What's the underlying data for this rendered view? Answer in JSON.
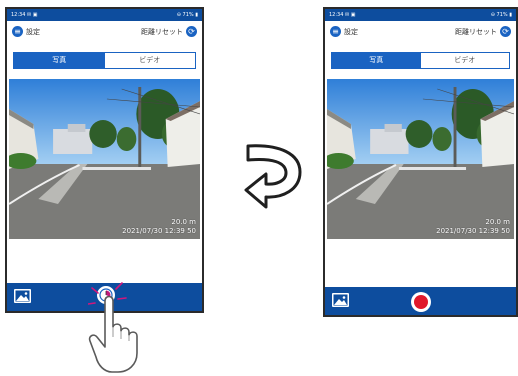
{
  "left_phone": {
    "statusbar": {
      "time": "12:34 ✉ ▣",
      "right": "⊖ 71% ▮"
    },
    "appbar": {
      "settings_label": "設定",
      "reset_label": "距離リセット"
    },
    "tabs": {
      "photo": "写真",
      "video": "ビデオ",
      "active": "photo"
    },
    "overlay": {
      "distance": "20.0 m",
      "datetime": "2021/07/30 12:39 50"
    }
  },
  "right_phone": {
    "statusbar": {
      "time": "12:34 ✉ ▣",
      "right": "⊖ 71% ▮"
    },
    "appbar": {
      "settings_label": "設定",
      "reset_label": "距離リセット"
    },
    "tabs": {
      "photo": "写真",
      "video": "ビデオ",
      "active": "photo"
    },
    "overlay": {
      "distance": "20.0 m",
      "datetime": "2021/07/30 12:39 50"
    }
  },
  "colors": {
    "primary": "#1a63c2",
    "bar": "#0d4d9e",
    "record": "#e0182b"
  },
  "icons": {
    "settings": "gear-circle-icon",
    "reset": "refresh-circle-icon",
    "gallery": "image-icon",
    "timer": "timer-shutter-icon",
    "record": "record-dot-icon",
    "transition_arrow": "curved-arrow-left-icon",
    "hand": "tapping-hand-icon"
  }
}
